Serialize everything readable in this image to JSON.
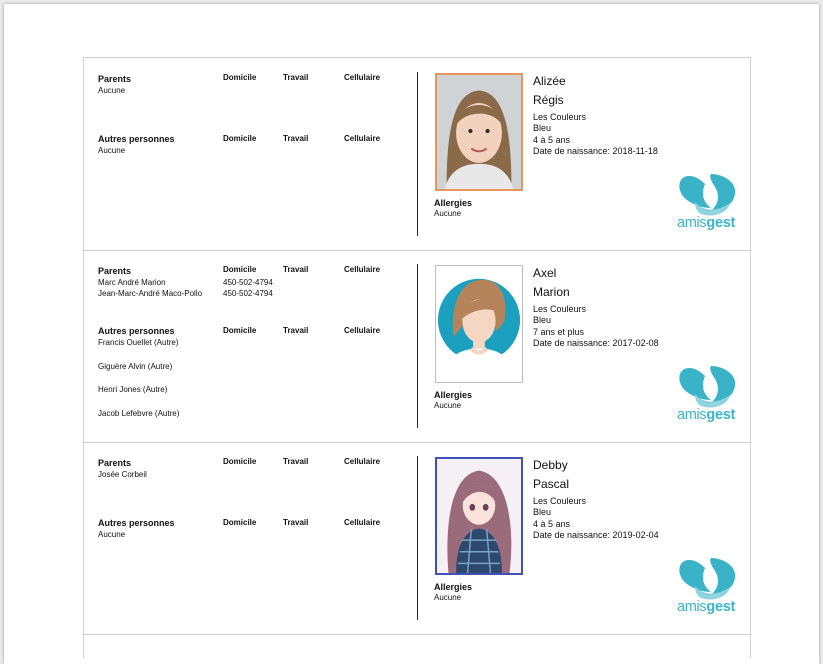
{
  "labels": {
    "parents": "Parents",
    "others": "Autres personnes",
    "home": "Domicile",
    "work": "Travail",
    "cell": "Cellulaire",
    "allergies": "Allergies",
    "none": "Aucune"
  },
  "logo": {
    "part1": "amis",
    "part2": "gest",
    "colors": [
      "#3ab3c8",
      "#8fd3df"
    ]
  },
  "children": [
    {
      "first_name": "Alizée",
      "last_name": "Régis",
      "group": "Les Couleurs",
      "color": "Bleu",
      "age_group": "4 à 5 ans",
      "birth_label": "Date de naissance: 2018-11-18",
      "parents": [],
      "others": [],
      "allergies": "Aucune",
      "photo_border": "#e8955a"
    },
    {
      "first_name": "Axel",
      "last_name": "Marion",
      "group": "Les Couleurs",
      "color": "Bleu",
      "age_group": "7 ans et plus",
      "birth_label": "Date de naissance: 2017-02-08",
      "parents": [
        {
          "name": "Marc André Marion",
          "home": "450-502-4794"
        },
        {
          "name": "Jean-Marc-André Maco-Pollo",
          "home": "450-502-4794"
        }
      ],
      "others": [
        {
          "name": "Francis Ouellet (Autre)"
        },
        {
          "name": "Giguère Alvin (Autre)"
        },
        {
          "name": "Henri Jones (Autre)"
        },
        {
          "name": "Jacob Lefebvre (Autre)"
        }
      ],
      "allergies": "Aucune",
      "photo_border": "#bdbdbd"
    },
    {
      "first_name": "Debby",
      "last_name": "Pascal",
      "group": "Les Couleurs",
      "color": "Bleu",
      "age_group": "4 à 5 ans",
      "birth_label": "Date de naissance: 2019-02-04",
      "parents": [
        {
          "name": "Josée Corbeil"
        }
      ],
      "others": [],
      "allergies": "Aucune",
      "photo_border": "#3f51b5"
    }
  ]
}
